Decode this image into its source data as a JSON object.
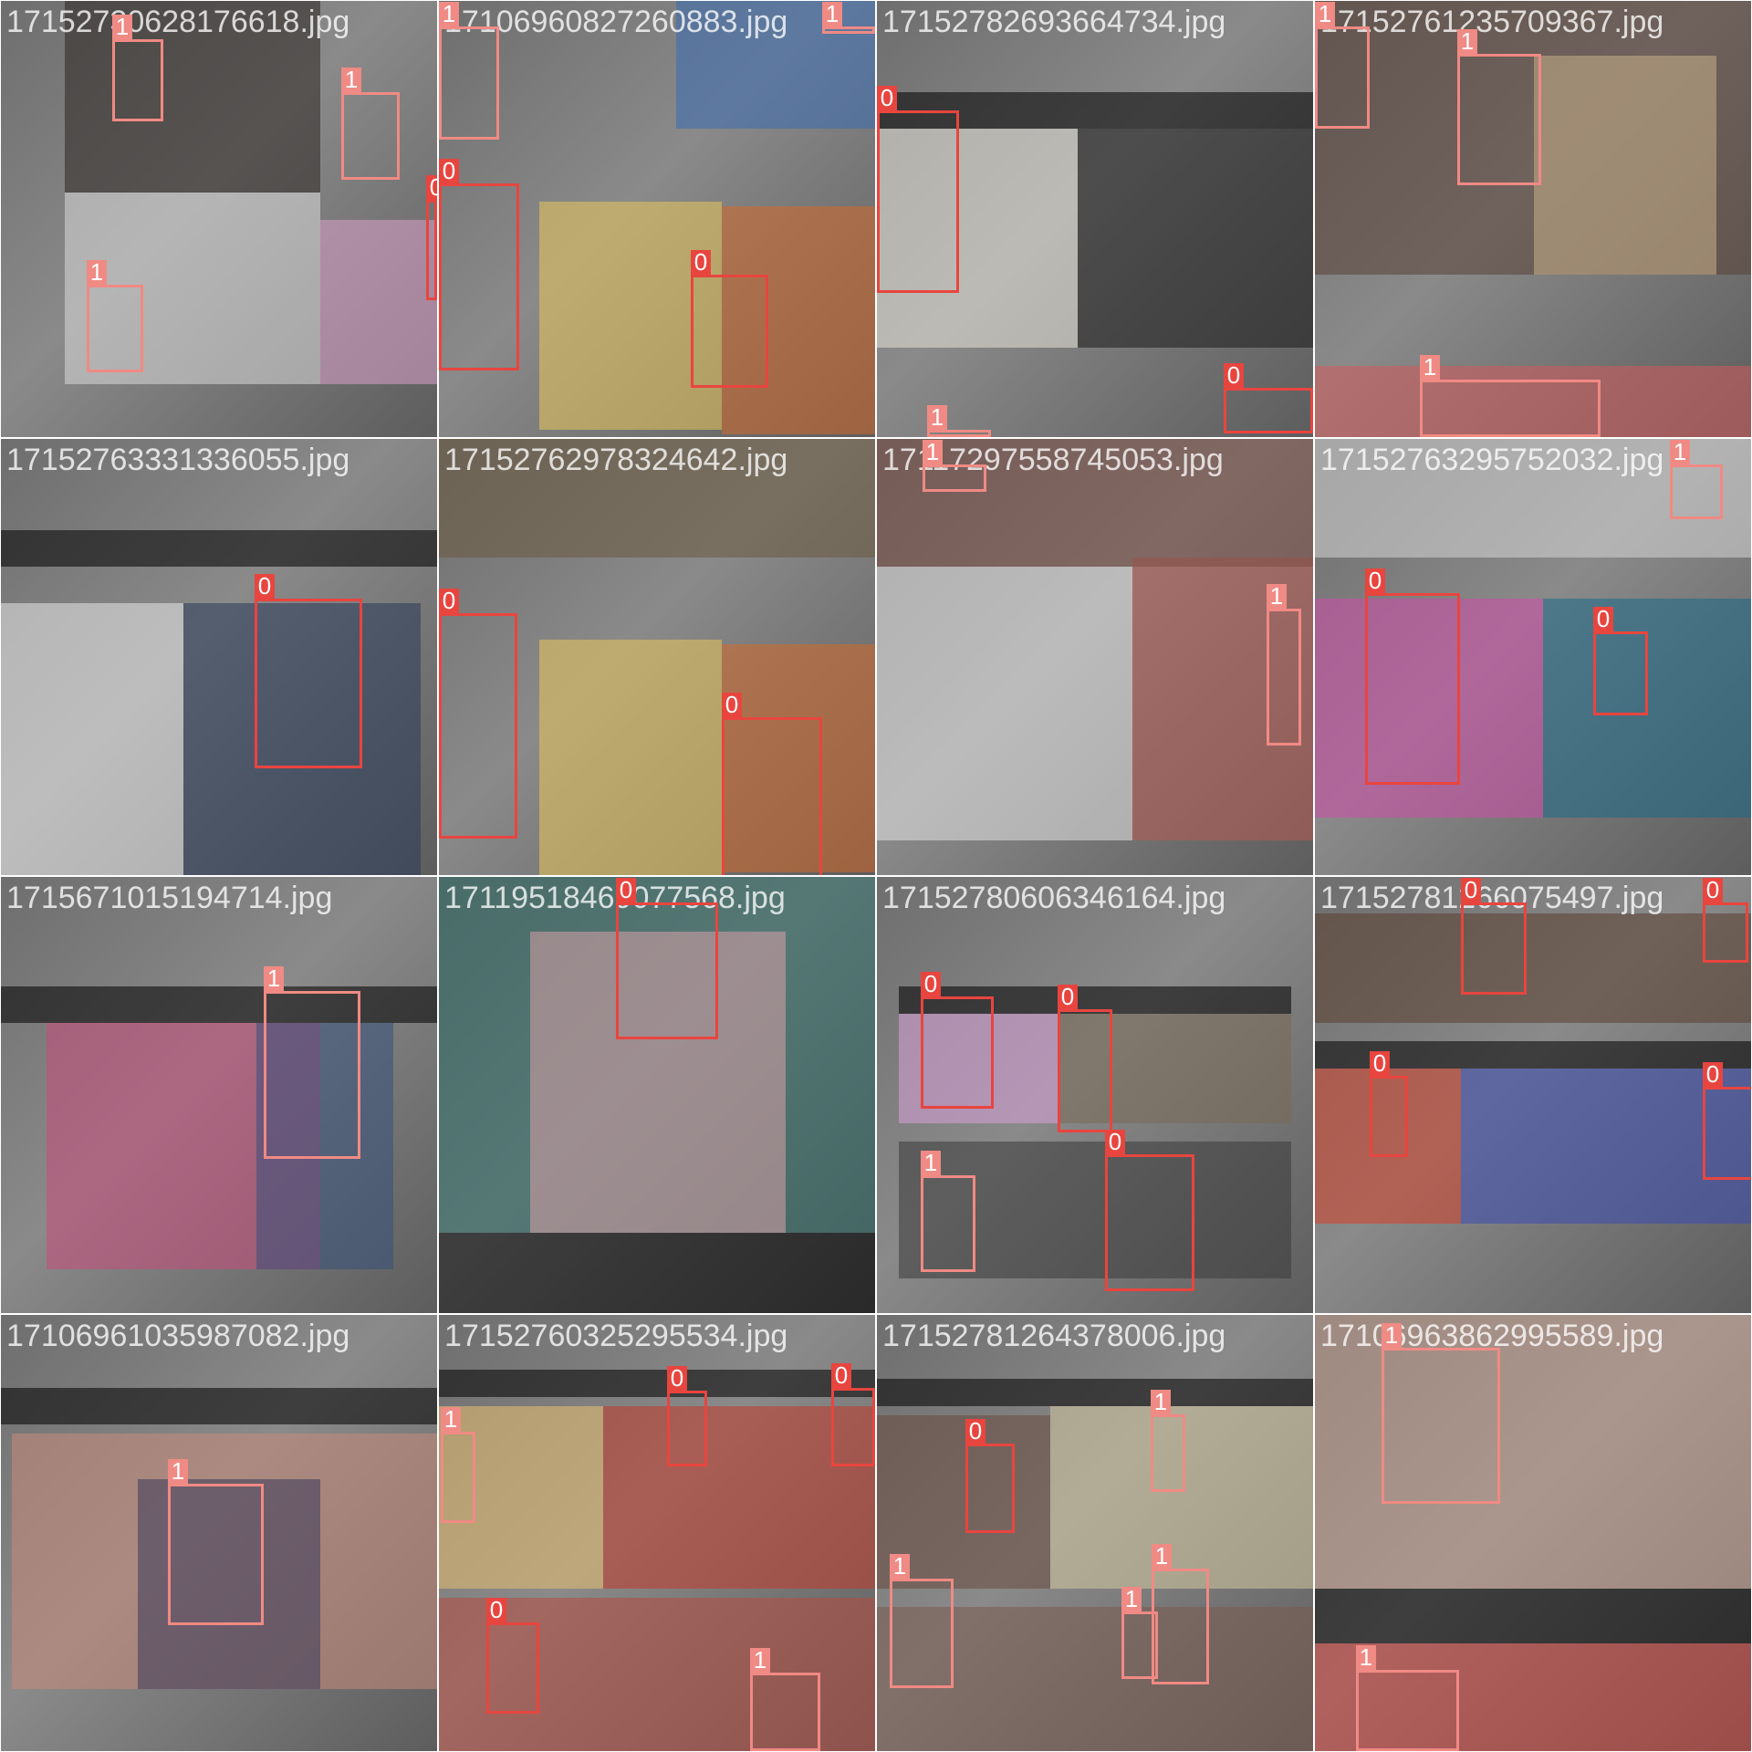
{
  "colors": {
    "class_0": "#e8453f",
    "class_1": "#f08a84",
    "tile_background": "#7f7f7f"
  },
  "tiles": [
    {
      "filename": "17152730628176618.jpg",
      "boxes": [
        {
          "label": "1"
        },
        {
          "label": "1"
        },
        {
          "label": "1"
        },
        {
          "label": "0"
        }
      ]
    },
    {
      "filename": "17106960827260883.jpg",
      "boxes": [
        {
          "label": "1"
        },
        {
          "label": "1"
        },
        {
          "label": "0"
        },
        {
          "label": "0"
        }
      ]
    },
    {
      "filename": "17152782693664734.jpg",
      "boxes": [
        {
          "label": "0"
        },
        {
          "label": "0"
        },
        {
          "label": "1"
        }
      ]
    },
    {
      "filename": "17152761235709367.jpg",
      "boxes": [
        {
          "label": "1"
        },
        {
          "label": "1"
        },
        {
          "label": "1"
        }
      ]
    },
    {
      "filename": "17152763331336055.jpg",
      "boxes": [
        {
          "label": "0"
        }
      ]
    },
    {
      "filename": "17152762978324642.jpg",
      "boxes": [
        {
          "label": "0"
        },
        {
          "label": "0"
        }
      ]
    },
    {
      "filename": "17117297558745053.jpg",
      "boxes": [
        {
          "label": "1"
        },
        {
          "label": "1"
        }
      ]
    },
    {
      "filename": "17152763295752032.jpg",
      "boxes": [
        {
          "label": "1"
        },
        {
          "label": "0"
        },
        {
          "label": "0"
        }
      ]
    },
    {
      "filename": "1715671015194714.jpg",
      "boxes": [
        {
          "label": "1"
        }
      ]
    },
    {
      "filename": "17119518469077568.jpg",
      "boxes": [
        {
          "label": "0"
        }
      ]
    },
    {
      "filename": "17152780606346164.jpg",
      "boxes": [
        {
          "label": "0"
        },
        {
          "label": "0"
        },
        {
          "label": "0"
        },
        {
          "label": "1"
        }
      ]
    },
    {
      "filename": "17152781266075497.jpg",
      "boxes": [
        {
          "label": "0"
        },
        {
          "label": "0"
        },
        {
          "label": "0"
        },
        {
          "label": "0"
        }
      ]
    },
    {
      "filename": "17106961035987082.jpg",
      "boxes": [
        {
          "label": "1"
        }
      ]
    },
    {
      "filename": "17152760325295534.jpg",
      "boxes": [
        {
          "label": "1"
        },
        {
          "label": "0"
        },
        {
          "label": "0"
        },
        {
          "label": "0"
        },
        {
          "label": "1"
        }
      ]
    },
    {
      "filename": "17152781264378006.jpg",
      "boxes": [
        {
          "label": "0"
        },
        {
          "label": "1"
        },
        {
          "label": "1"
        },
        {
          "label": "1"
        },
        {
          "label": "1"
        }
      ]
    },
    {
      "filename": "17106963862995589.jpg",
      "boxes": [
        {
          "label": "1"
        },
        {
          "label": "1"
        }
      ]
    }
  ]
}
